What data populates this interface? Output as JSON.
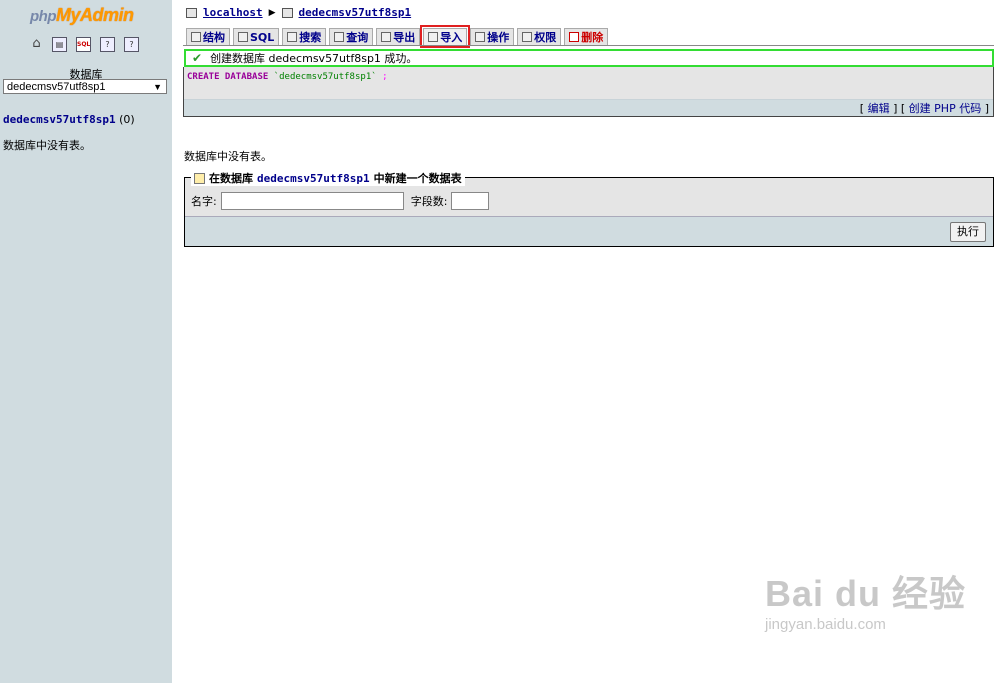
{
  "left": {
    "logo_php": "php",
    "logo_myadmin": "MyAdmin",
    "quicklinks": [
      "home-icon",
      "query-window-icon",
      "sql-icon",
      "docs-icon",
      "help-icon"
    ],
    "db_label": "数据库",
    "db_select_value": "dedecmsv57utf8sp1",
    "db_name": "dedecmsv57utf8sp1",
    "db_count": "(0)",
    "no_tables": "数据库中没有表。"
  },
  "breadcrumb": {
    "server": "localhost",
    "database": "dedecmsv57utf8sp1"
  },
  "tabs": [
    {
      "label": "结构",
      "icon": "structure-icon"
    },
    {
      "label": "SQL",
      "icon": "sql-icon"
    },
    {
      "label": "搜索",
      "icon": "search-icon"
    },
    {
      "label": "查询",
      "icon": "query-icon"
    },
    {
      "label": "导出",
      "icon": "export-icon"
    },
    {
      "label": "导入",
      "icon": "import-icon"
    },
    {
      "label": "操作",
      "icon": "operations-icon"
    },
    {
      "label": "权限",
      "icon": "privileges-icon"
    },
    {
      "label": "删除",
      "icon": "drop-icon"
    }
  ],
  "message": {
    "success": "创建数据库 dedecmsv57utf8sp1 成功。",
    "sql_keyword": "CREATE DATABASE",
    "sql_name": "`dedecmsv57utf8sp1`",
    "sql_end": ";",
    "edit_link": "编辑",
    "php_link": "创建 PHP 代码"
  },
  "main": {
    "no_tables": "数据库中没有表。"
  },
  "create_table": {
    "legend_prefix": "在数据库",
    "legend_db": "dedecmsv57utf8sp1",
    "legend_suffix": "中新建一个数据表",
    "name_label": "名字:",
    "fields_label": "字段数:",
    "name_value": "",
    "fields_value": "",
    "go_button": "执行"
  },
  "watermark": {
    "logo": "Bai du 经验",
    "url": "jingyan.baidu.com"
  },
  "colors": {
    "left_bg": "#d0dce0",
    "link": "#00008b",
    "success_border": "#33dd33",
    "highlight_box": "#e02020"
  }
}
